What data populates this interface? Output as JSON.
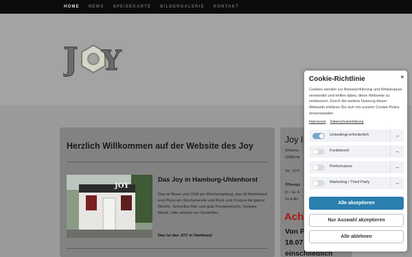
{
  "nav": {
    "items": [
      {
        "label": "HOME",
        "active": true
      },
      {
        "label": "NEWS",
        "active": false
      },
      {
        "label": "SPEISEKARTE",
        "active": false
      },
      {
        "label": "BILDERGALERIE",
        "active": false
      },
      {
        "label": "KONTAKT",
        "active": false
      }
    ]
  },
  "logo": {
    "text": "JOY"
  },
  "main": {
    "welcome": "Herzlich Willkommen auf der Website des Joy",
    "article_title": "Das Joy in Hamburg-Uhlenhorst",
    "article_body": "Das ist Blues und Chilli am Wochenanfang, das ist Motörhead und Pizza am Wochenende und Rock und Croque die ganze Woche. Schnelles Bier und gute Kneipenküche, hörbare Musik, oder einfach nur Genießen.",
    "article_cta": "Das ist das JOY in Hamburg!",
    "photo_sign": "JOY"
  },
  "side": {
    "title": "Joy I",
    "line1": "Winterhu",
    "line2": "22085 Ha",
    "line3": "Tel.: 2270",
    "hours_label": "Öffnungs",
    "hours1": "Di - Sa: A",
    "hours2": "So & Mo",
    "red_text": "Ach",
    "big1": "Von F",
    "big2": "18.07",
    "big3": "einschließlich"
  },
  "cookie": {
    "title": "Cookie-Richtlinie",
    "close": "×",
    "text": "Cookies werden zur Benutzerführung und Webanalyse verwendet und helfen dabei, diese Webseite zu verbessern. Durch die weitere Nutzung dieser Webseite erklären Sie sich mit unserer Cookie-Police einverstanden.",
    "link_impressum": "Impressum",
    "link_privacy": "Datenschutzerklärung",
    "categories": [
      {
        "label": "Unbedingt erforderlich",
        "on": true
      },
      {
        "label": "Funktionell",
        "on": false
      },
      {
        "label": "Performance",
        "on": false
      },
      {
        "label": "Marketing / Third Party",
        "on": false
      }
    ],
    "arrow": "→",
    "btn_accept_all": "Alle akzeptieren",
    "btn_accept_selection": "Nur Auswahl akzeptieren",
    "btn_reject_all": "Alle ablehnen"
  },
  "colors": {
    "accent": "#2a7fae",
    "toggle_on": "#7aa7c9",
    "red": "#b01515"
  }
}
